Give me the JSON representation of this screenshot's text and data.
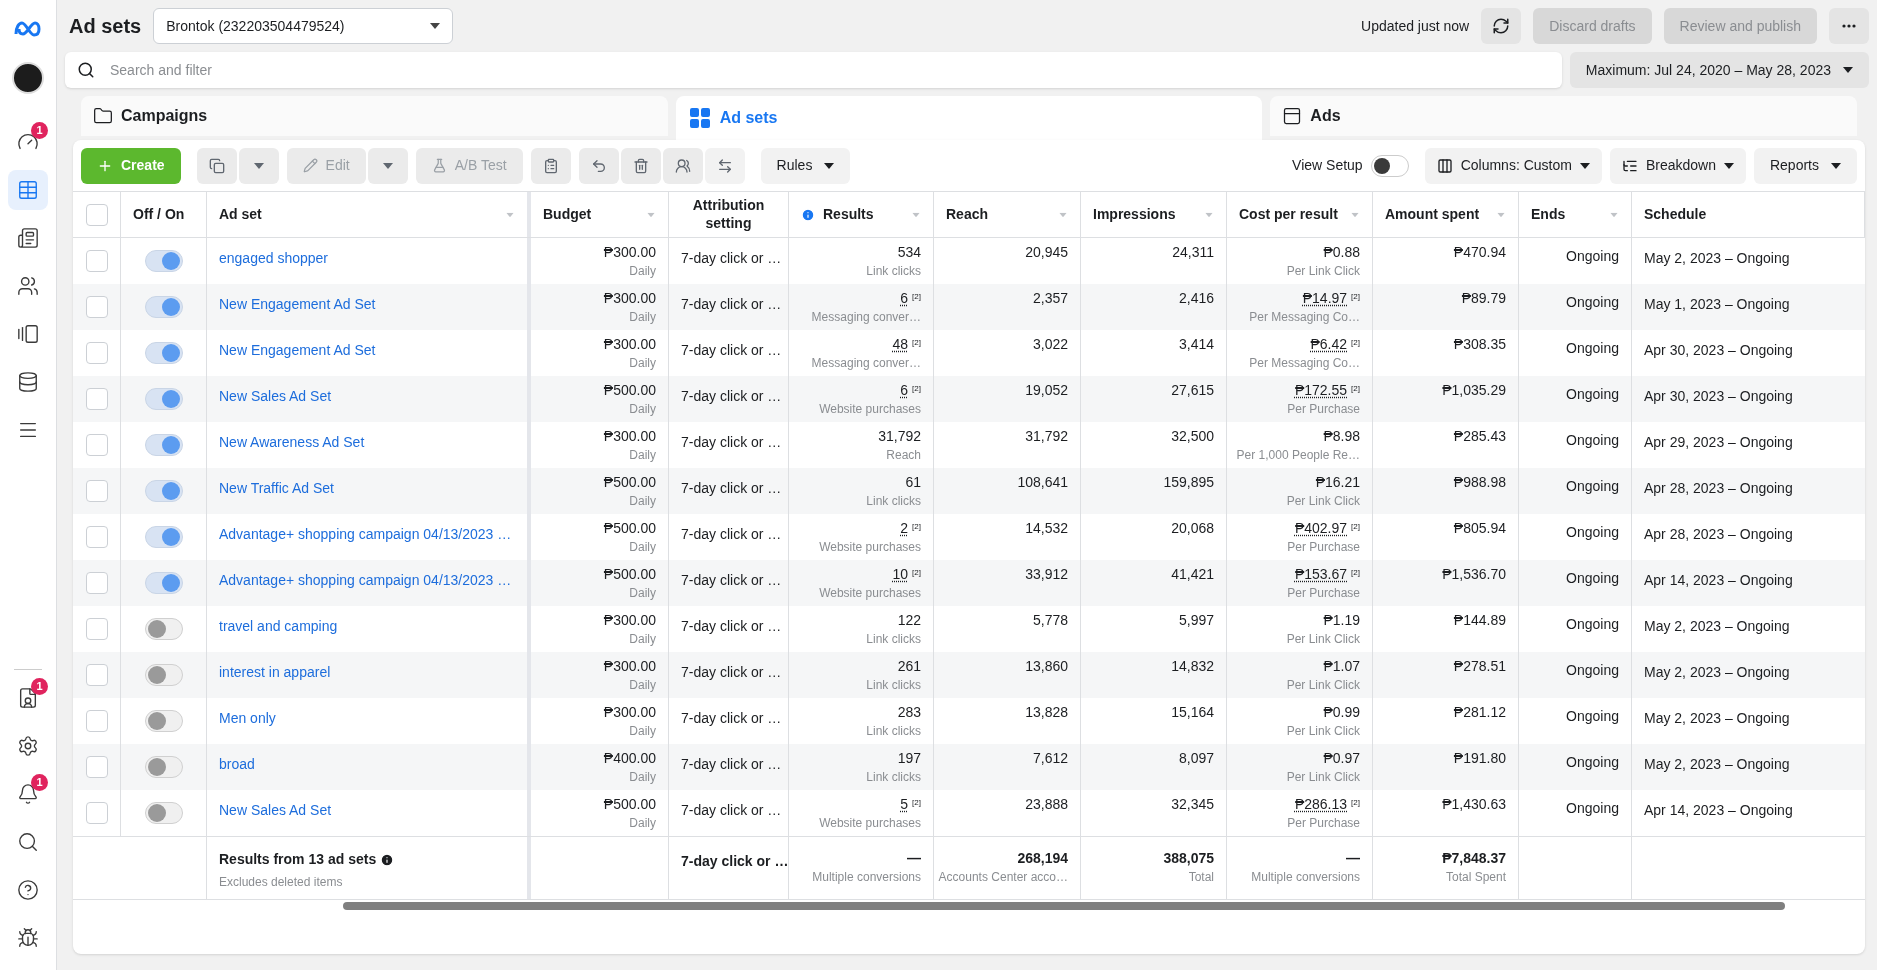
{
  "sidebar": {
    "items": [
      {
        "selected": false,
        "badge": "1"
      },
      {
        "selected": true
      },
      {
        "selected": false
      },
      {
        "selected": false
      },
      {
        "selected": false
      },
      {
        "selected": false
      },
      {
        "selected": false
      }
    ],
    "bottom_items": [
      {
        "selected": false,
        "badge": "1"
      },
      {
        "selected": false
      },
      {
        "selected": false,
        "badge": "1"
      },
      {
        "selected": false
      },
      {
        "selected": false
      },
      {
        "selected": false
      }
    ]
  },
  "select_all": {
    "checked": false
  },
  "header": {
    "title": "Ad sets",
    "account": "Brontok (232203504479524)",
    "status": "Updated just now",
    "discard": {
      "label": "Discard drafts",
      "disabled": true
    },
    "publish": {
      "label": "Review and publish",
      "disabled": true
    }
  },
  "search": {
    "placeholder": "Search and filter"
  },
  "date_range": "Maximum: Jul 24, 2020 – May 28, 2023",
  "tabs": [
    {
      "label": "Campaigns",
      "selected": false
    },
    {
      "label": "Ad sets",
      "selected": true
    },
    {
      "label": "Ads",
      "selected": false
    }
  ],
  "toolbar": {
    "create": "Create",
    "edit": {
      "label": "Edit",
      "disabled": true
    },
    "ab_test": {
      "label": "A/B Test",
      "disabled": true
    },
    "rules": "Rules",
    "view_setup": {
      "label": "View Setup",
      "on": false
    },
    "columns": "Columns: Custom",
    "breakdown": "Breakdown",
    "reports": "Reports"
  },
  "columns": [
    {
      "label": "Off / On",
      "sortable": false
    },
    {
      "label": "Ad set",
      "sortable": true
    },
    {
      "label": "Budget",
      "sortable": true
    },
    {
      "label": "Attribution setting",
      "sortable": false
    },
    {
      "label": "Results",
      "sortable": true,
      "info": true
    },
    {
      "label": "Reach",
      "sortable": true
    },
    {
      "label": "Impressions",
      "sortable": true
    },
    {
      "label": "Cost per result",
      "sortable": true
    },
    {
      "label": "Amount spent",
      "sortable": true
    },
    {
      "label": "Ends",
      "sortable": true
    },
    {
      "label": "Schedule",
      "sortable": false
    }
  ],
  "rows": [
    {
      "on": true,
      "name": "engaged shopper",
      "budget": "₱300.00",
      "period": "Daily",
      "attribution": "7-day click or …",
      "result": "534",
      "result_label": "Link clicks",
      "reach": "20,945",
      "impressions": "24,311",
      "cost": "₱0.88",
      "cost_label": "Per Link Click",
      "spent": "₱470.94",
      "checked": false,
      "ends": "Ongoing",
      "schedule": "May 2, 2023 – Ongoing"
    },
    {
      "on": true,
      "name": "New Engagement Ad Set",
      "budget": "₱300.00",
      "period": "Daily",
      "attribution": "7-day click or …",
      "result": "6",
      "result_note": "[2]",
      "result_label": "Messaging conver…",
      "reach": "2,357",
      "impressions": "2,416",
      "cost": "₱14.97",
      "cost_note": "[2]",
      "cost_label": "Per Messaging Co…",
      "spent": "₱89.79",
      "checked": false,
      "ends": "Ongoing",
      "schedule": "May 1, 2023 – Ongoing"
    },
    {
      "on": true,
      "name": "New Engagement Ad Set",
      "budget": "₱300.00",
      "period": "Daily",
      "attribution": "7-day click or …",
      "result": "48",
      "result_note": "[2]",
      "result_label": "Messaging conver…",
      "reach": "3,022",
      "impressions": "3,414",
      "cost": "₱6.42",
      "cost_note": "[2]",
      "cost_label": "Per Messaging Co…",
      "spent": "₱308.35",
      "checked": false,
      "ends": "Ongoing",
      "schedule": "Apr 30, 2023 – Ongoing"
    },
    {
      "on": true,
      "name": "New Sales Ad Set",
      "budget": "₱500.00",
      "period": "Daily",
      "attribution": "7-day click or …",
      "result": "6",
      "result_note": "[2]",
      "result_label": "Website purchases",
      "reach": "19,052",
      "impressions": "27,615",
      "cost": "₱172.55",
      "cost_note": "[2]",
      "cost_label": "Per Purchase",
      "spent": "₱1,035.29",
      "checked": false,
      "ends": "Ongoing",
      "schedule": "Apr 30, 2023 – Ongoing"
    },
    {
      "on": true,
      "name": "New Awareness Ad Set",
      "budget": "₱300.00",
      "period": "Daily",
      "attribution": "7-day click or …",
      "result": "31,792",
      "result_label": "Reach",
      "reach": "31,792",
      "impressions": "32,500",
      "cost": "₱8.98",
      "cost_label": "Per 1,000 People Re…",
      "spent": "₱285.43",
      "checked": false,
      "ends": "Ongoing",
      "schedule": "Apr 29, 2023 – Ongoing"
    },
    {
      "on": true,
      "name": "New Traffic Ad Set",
      "budget": "₱500.00",
      "period": "Daily",
      "attribution": "7-day click or …",
      "result": "61",
      "result_label": "Link clicks",
      "reach": "108,641",
      "impressions": "159,895",
      "cost": "₱16.21",
      "cost_label": "Per Link Click",
      "spent": "₱988.98",
      "checked": false,
      "ends": "Ongoing",
      "schedule": "Apr 28, 2023 – Ongoing"
    },
    {
      "on": true,
      "name": "Advantage+ shopping campaign 04/13/2023 …",
      "budget": "₱500.00",
      "period": "Daily",
      "attribution": "7-day click or …",
      "result": "2",
      "result_note": "[2]",
      "result_label": "Website purchases",
      "reach": "14,532",
      "impressions": "20,068",
      "cost": "₱402.97",
      "cost_note": "[2]",
      "cost_label": "Per Purchase",
      "spent": "₱805.94",
      "checked": false,
      "ends": "Ongoing",
      "schedule": "Apr 28, 2023 – Ongoing"
    },
    {
      "on": true,
      "name": "Advantage+ shopping campaign 04/13/2023 …",
      "budget": "₱500.00",
      "period": "Daily",
      "attribution": "7-day click or …",
      "result": "10",
      "result_note": "[2]",
      "result_label": "Website purchases",
      "reach": "33,912",
      "impressions": "41,421",
      "cost": "₱153.67",
      "cost_note": "[2]",
      "cost_label": "Per Purchase",
      "spent": "₱1,536.70",
      "checked": false,
      "ends": "Ongoing",
      "schedule": "Apr 14, 2023 – Ongoing"
    },
    {
      "on": false,
      "name": "travel and camping",
      "budget": "₱300.00",
      "period": "Daily",
      "attribution": "7-day click or …",
      "result": "122",
      "result_label": "Link clicks",
      "reach": "5,778",
      "impressions": "5,997",
      "cost": "₱1.19",
      "cost_label": "Per Link Click",
      "spent": "₱144.89",
      "checked": false,
      "ends": "Ongoing",
      "schedule": "May 2, 2023 – Ongoing"
    },
    {
      "on": false,
      "name": "interest in apparel",
      "budget": "₱300.00",
      "period": "Daily",
      "attribution": "7-day click or …",
      "result": "261",
      "result_label": "Link clicks",
      "reach": "13,860",
      "impressions": "14,832",
      "cost": "₱1.07",
      "cost_label": "Per Link Click",
      "spent": "₱278.51",
      "checked": false,
      "ends": "Ongoing",
      "schedule": "May 2, 2023 – Ongoing"
    },
    {
      "on": false,
      "name": "Men only",
      "budget": "₱300.00",
      "period": "Daily",
      "attribution": "7-day click or …",
      "result": "283",
      "result_label": "Link clicks",
      "reach": "13,828",
      "impressions": "15,164",
      "cost": "₱0.99",
      "cost_label": "Per Link Click",
      "spent": "₱281.12",
      "checked": false,
      "ends": "Ongoing",
      "schedule": "May 2, 2023 – Ongoing"
    },
    {
      "on": false,
      "name": "broad",
      "budget": "₱400.00",
      "period": "Daily",
      "attribution": "7-day click or …",
      "result": "197",
      "result_label": "Link clicks",
      "reach": "7,612",
      "impressions": "8,097",
      "cost": "₱0.97",
      "cost_label": "Per Link Click",
      "spent": "₱191.80",
      "checked": false,
      "ends": "Ongoing",
      "schedule": "May 2, 2023 – Ongoing"
    },
    {
      "on": false,
      "name": "New Sales Ad Set",
      "budget": "₱500.00",
      "period": "Daily",
      "attribution": "7-day click or …",
      "result": "5",
      "result_note": "[2]",
      "result_label": "Website purchases",
      "reach": "23,888",
      "impressions": "32,345",
      "cost": "₱286.13",
      "cost_note": "[2]",
      "cost_label": "Per Purchase",
      "spent": "₱1,430.63",
      "checked": false,
      "ends": "Ongoing",
      "schedule": "Apr 14, 2023 – Ongoing"
    }
  ],
  "totals": {
    "label": "Results from 13 ad sets",
    "sublabel": "Excludes deleted items",
    "attribution": "7-day click or …",
    "result": "—",
    "result_label": "Multiple conversions",
    "reach": "268,194",
    "reach_label": "Accounts Center acco…",
    "impressions": "388,075",
    "impressions_label": "Total",
    "cost": "—",
    "cost_label": "Multiple conversions",
    "spent": "₱7,848.37",
    "spent_label": "Total Spent"
  }
}
